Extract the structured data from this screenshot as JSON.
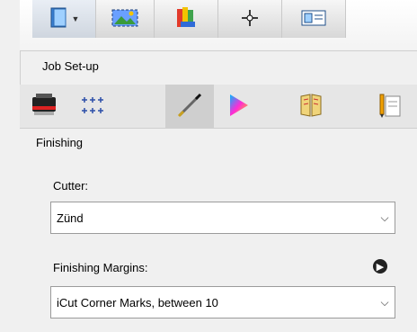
{
  "window": {
    "title": "Job Set-up"
  },
  "toolbar_top": {
    "tabs": [
      {
        "icon": "book-dropdown-icon"
      },
      {
        "icon": "image-transform-icon"
      },
      {
        "icon": "color-swatch-icon"
      },
      {
        "icon": "crosshair-icon"
      },
      {
        "icon": "card-layout-icon"
      }
    ]
  },
  "icon_tabs": [
    {
      "icon": "printer-icon"
    },
    {
      "icon": "grid-marks-icon"
    },
    {
      "icon": "knife-icon"
    },
    {
      "icon": "color-triangle-icon"
    },
    {
      "icon": "booklet-icon"
    },
    {
      "icon": "pencil-document-icon"
    }
  ],
  "panel": {
    "section_title": "Finishing",
    "cutter": {
      "label": "Cutter:",
      "value": "Zünd"
    },
    "margins": {
      "label": "Finishing Margins:",
      "value": "iCut Corner Marks, between 10"
    }
  }
}
